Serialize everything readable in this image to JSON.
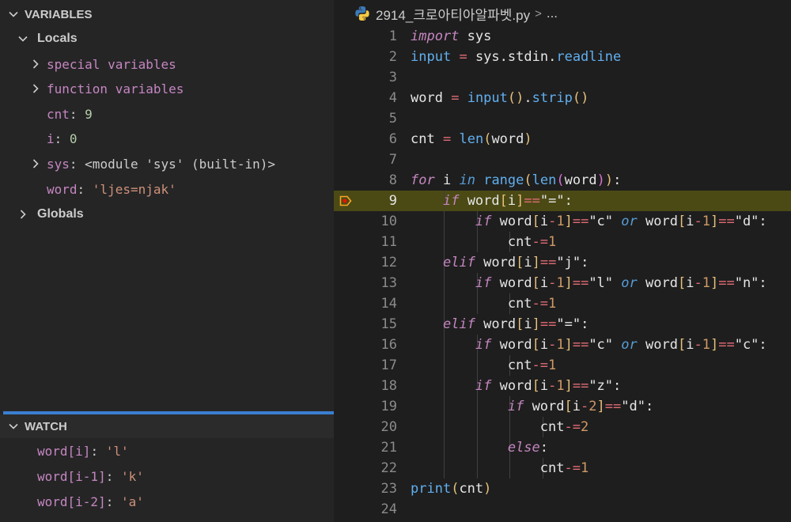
{
  "variables": {
    "header": "VARIABLES",
    "locals_label": "Locals",
    "globals_label": "Globals",
    "items": [
      {
        "name": "special variables",
        "value": "",
        "expandable": true
      },
      {
        "name": "function variables",
        "value": "",
        "expandable": true
      },
      {
        "name": "cnt",
        "value": "9",
        "expandable": false,
        "kind": "num"
      },
      {
        "name": "i",
        "value": "0",
        "expandable": false,
        "kind": "num"
      },
      {
        "name": "sys",
        "value": "<module 'sys' (built-in)>",
        "expandable": true,
        "kind": "plain"
      },
      {
        "name": "word",
        "value": "'ljes=njak'",
        "expandable": false,
        "kind": "str"
      }
    ]
  },
  "watch": {
    "header": "WATCH",
    "items": [
      {
        "expr": "word[i]",
        "value": "'l'"
      },
      {
        "expr": "word[i-1]",
        "value": "'k'"
      },
      {
        "expr": "word[i-2]",
        "value": "'a'"
      }
    ]
  },
  "editor": {
    "file_name": "2914_크로아티아알파벳.py",
    "breadcrumb_more": "...",
    "current_line": 9,
    "icon": "python-file-icon",
    "lines": [
      "import sys",
      "input = sys.stdin.readline",
      "",
      "word = input().strip()",
      "",
      "cnt = len(word)",
      "",
      "for i in range(len(word)):",
      "    if word[i]==\"=\":",
      "        if word[i-1]==\"c\" or word[i-1]==\"d\":",
      "            cnt-=1",
      "    elif word[i]==\"j\":",
      "        if word[i-1]==\"l\" or word[i-1]==\"n\":",
      "            cnt-=1",
      "    elif word[i]==\"=\":",
      "        if word[i-1]==\"c\" or word[i-1]==\"c\":",
      "            cnt-=1",
      "        if word[i-1]==\"z\":",
      "            if word[i-2]==\"d\":",
      "                cnt-=2",
      "            else:",
      "                cnt-=1",
      "print(cnt)",
      ""
    ]
  },
  "colors": {
    "current_line_bg": "#4b4a15",
    "breakpoint": "#f5a623",
    "watch_bar": "#3a7fd1"
  }
}
